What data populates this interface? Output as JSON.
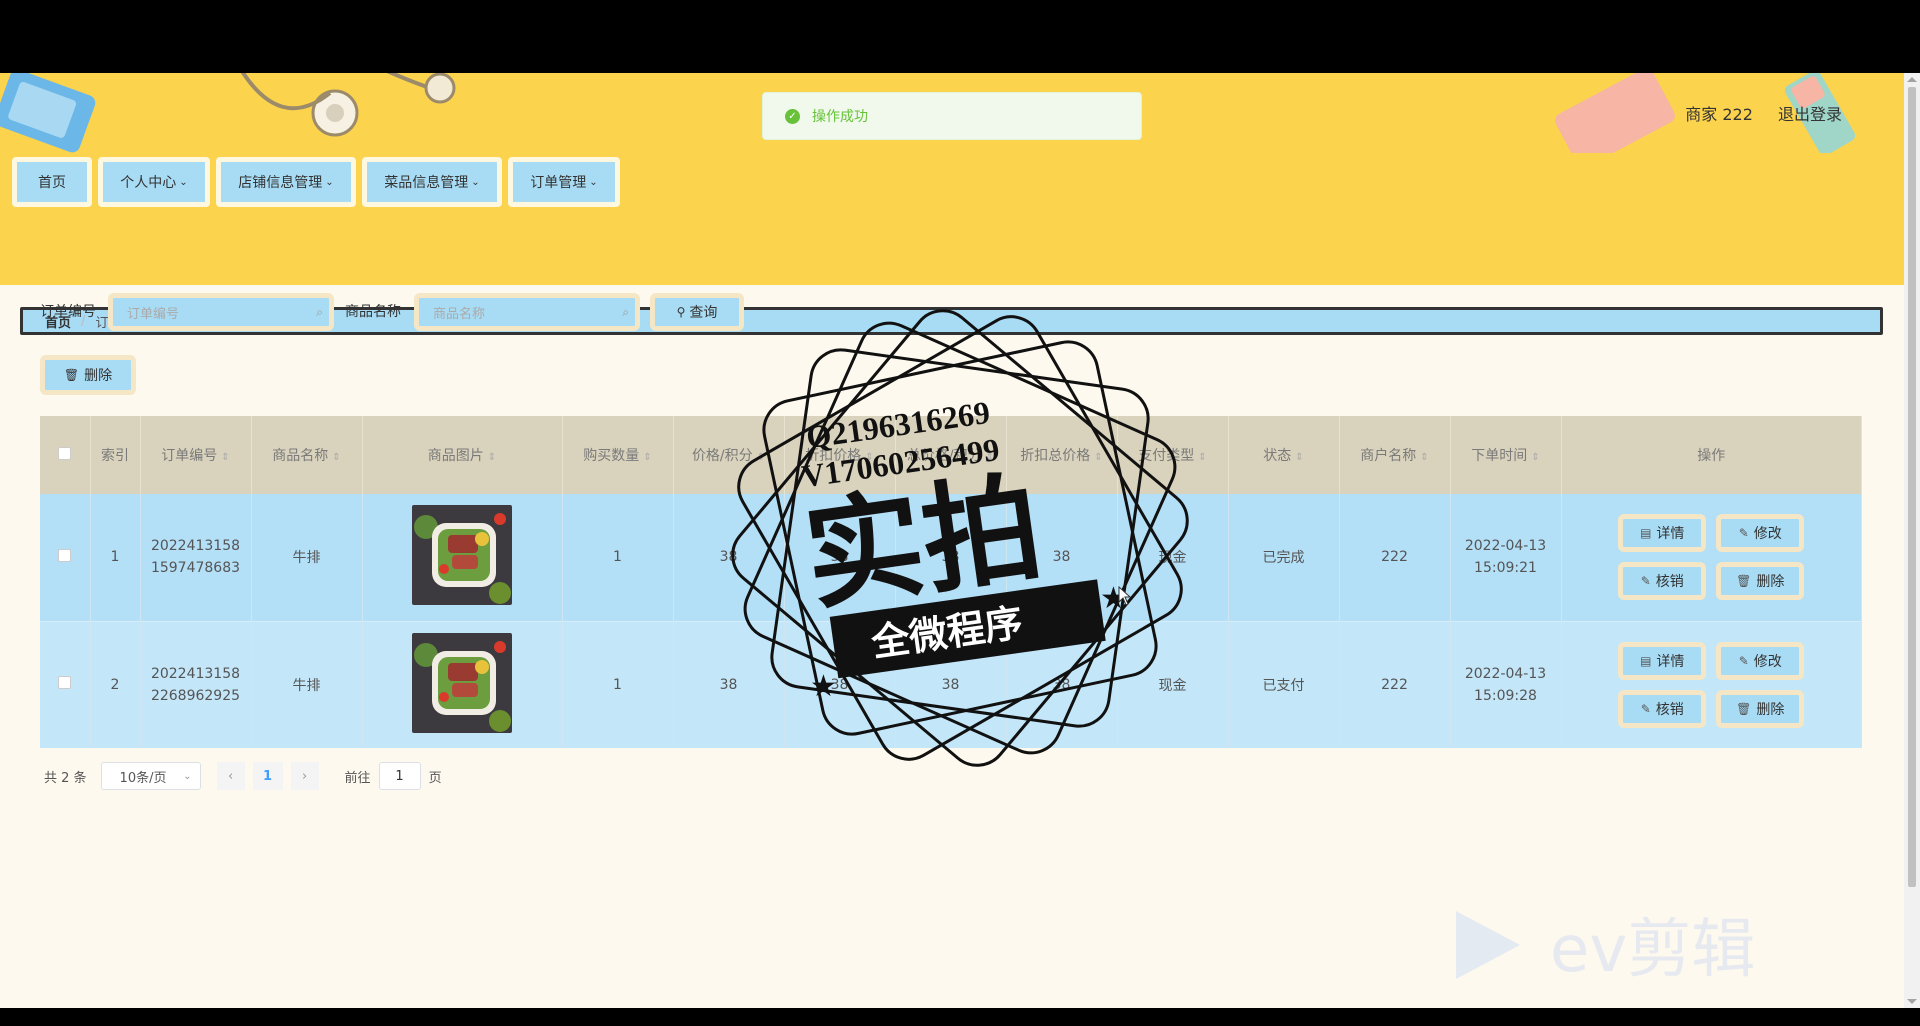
{
  "toast": {
    "text": "操作成功"
  },
  "user": {
    "name": "商家 222",
    "logout": "退出登录"
  },
  "nav": [
    {
      "label": "首页",
      "has_menu": false
    },
    {
      "label": "个人中心",
      "has_menu": true
    },
    {
      "label": "店铺信息管理",
      "has_menu": true
    },
    {
      "label": "菜品信息管理",
      "has_menu": true
    },
    {
      "label": "订单管理",
      "has_menu": true
    }
  ],
  "breadcrumb": {
    "home": "首页",
    "current": "订单管理"
  },
  "search": {
    "order_no_label": "订单编号",
    "order_no_placeholder": "订单编号",
    "product_label": "商品名称",
    "product_placeholder": "商品名称",
    "query_button": "查询"
  },
  "batch_delete": "删除",
  "table": {
    "headers": {
      "index": "索引",
      "order_no": "订单编号",
      "product": "商品名称",
      "image": "商品图片",
      "qty": "购买数量",
      "price": "价格/积分",
      "discount_price": "折扣价格",
      "total_points": "总价格/积分",
      "discount_total": "折扣总价格",
      "pay_type": "支付类型",
      "status": "状态",
      "merchant": "商户名称",
      "order_time": "下单时间",
      "actions": "操作"
    },
    "rows": [
      {
        "index": "1",
        "order_no": "20224131581597478683",
        "product": "牛排",
        "qty": "1",
        "price": "38",
        "discount_price": "38",
        "total_points": "38",
        "discount_total": "38",
        "pay_type": "现金",
        "status": "已完成",
        "merchant": "222",
        "order_time": "2022-04-13 15:09:21"
      },
      {
        "index": "2",
        "order_no": "20224131582268962925",
        "product": "牛排",
        "qty": "1",
        "price": "38",
        "discount_price": "38",
        "total_points": "38",
        "discount_total": "38",
        "pay_type": "现金",
        "status": "已支付",
        "merchant": "222",
        "order_time": "2022-04-13 15:09:28"
      }
    ],
    "actions": {
      "detail": "详情",
      "edit": "修改",
      "verify": "核销",
      "delete": "删除"
    }
  },
  "pagination": {
    "total": "共 2 条",
    "page_size": "10条/页",
    "current_page": "1",
    "goto_prefix": "前往",
    "goto_value": "1",
    "goto_suffix": "页"
  },
  "watermark": {
    "qq": "Q2196316269",
    "wechat": "V17060256499",
    "big": "实拍",
    "ribbon": "全微程序",
    "editor": "ev剪辑"
  },
  "colors": {
    "header_yellow": "#fcd34d",
    "button_blue": "#a8dcf5",
    "button_border": "#f5e6c5",
    "success_green": "#67c23a",
    "page_bg": "#fdf9ee"
  }
}
